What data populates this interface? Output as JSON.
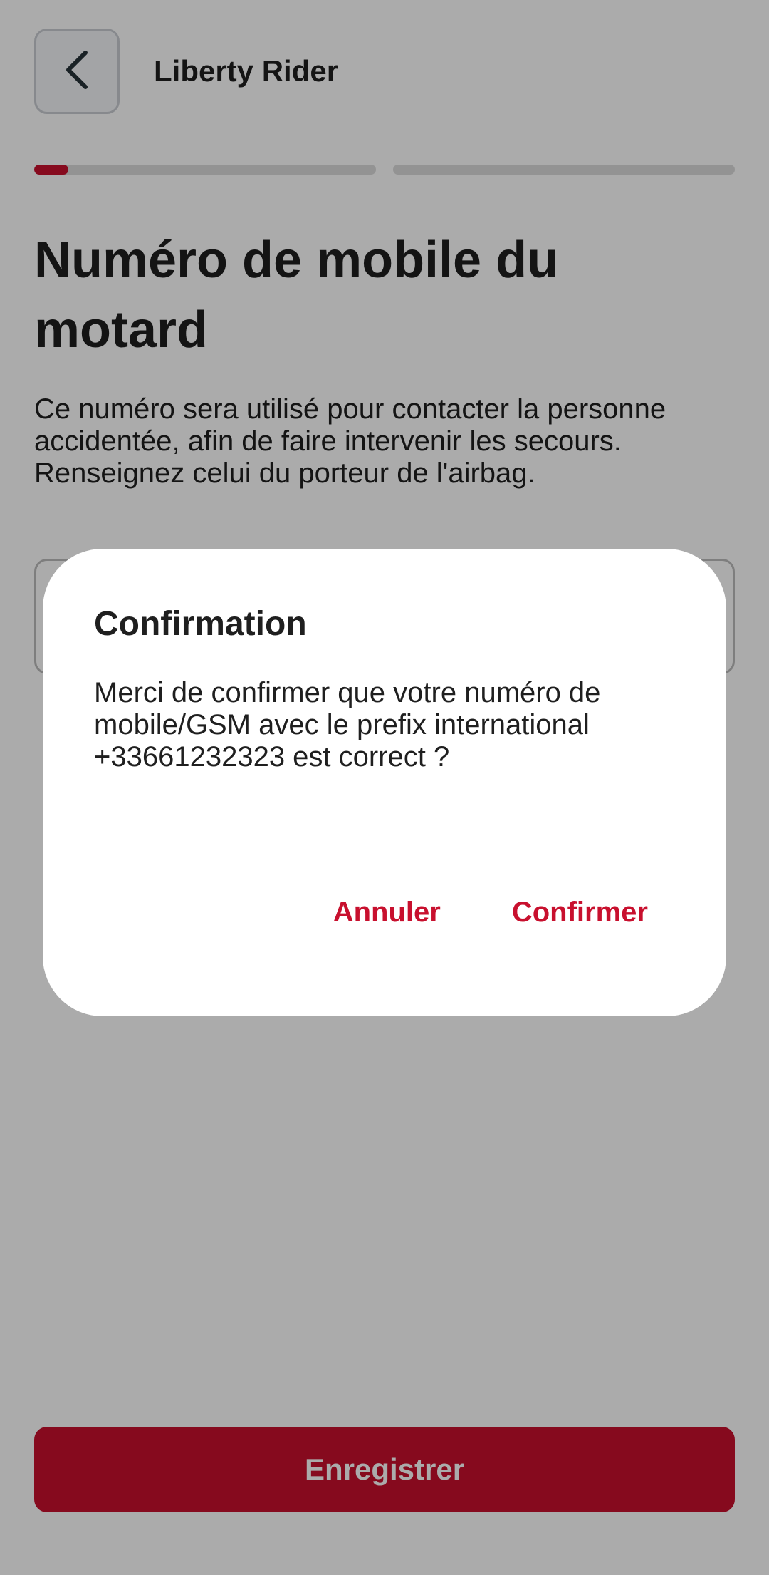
{
  "header": {
    "app_title": "Liberty Rider",
    "back_icon": "chevron-left-icon"
  },
  "progress": {
    "steps": [
      {
        "fill_fraction": 0.1
      },
      {
        "fill_fraction": 0.0
      }
    ],
    "accent_color": "#c8102e"
  },
  "main": {
    "title": "Numéro de mobile du motard",
    "description": "Ce numéro sera utilisé pour contacter la personne accidentée, afin de faire intervenir les secours. Renseignez celui du porteur de l'airbag.",
    "phone_input_value": ""
  },
  "footer": {
    "save_label": "Enregistrer"
  },
  "dialog": {
    "title": "Confirmation",
    "message": "Merci de confirmer que votre numéro de mobile/GSM avec le prefix international +33661232323 est correct ?",
    "cancel_label": "Annuler",
    "confirm_label": "Confirmer"
  },
  "colors": {
    "brand": "#c8102e",
    "text": "#1f1f1f"
  }
}
